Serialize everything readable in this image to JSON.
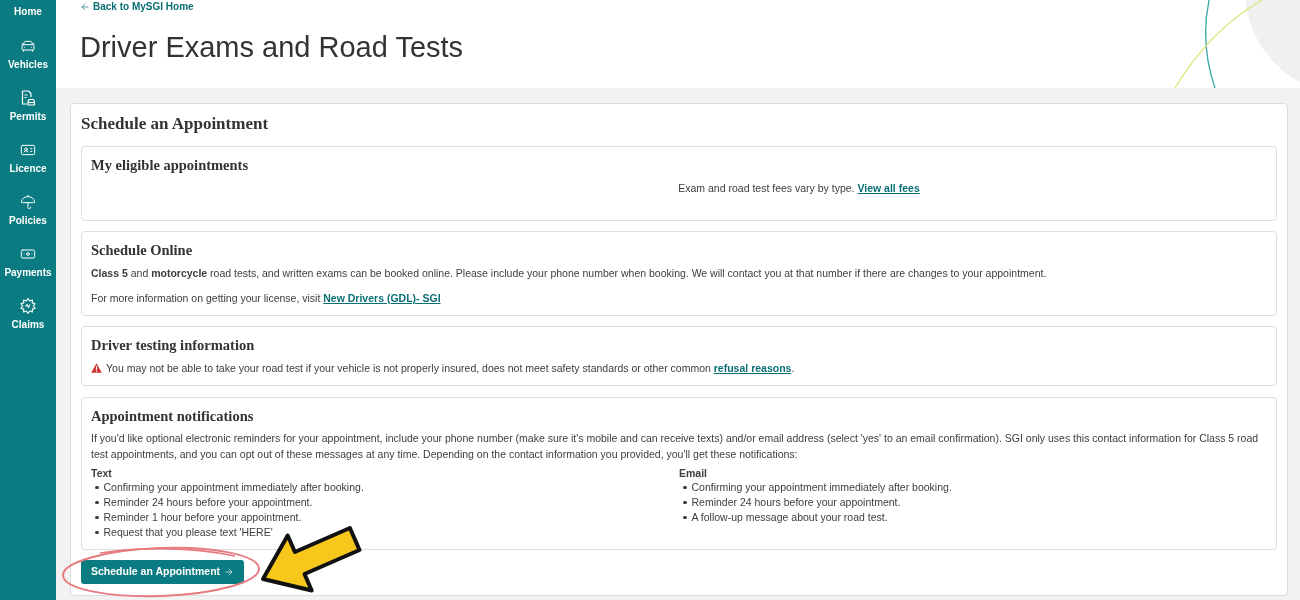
{
  "sidebar": {
    "items": [
      {
        "label": "Home"
      },
      {
        "label": "Vehicles"
      },
      {
        "label": "Permits"
      },
      {
        "label": "Licence"
      },
      {
        "label": "Policies"
      },
      {
        "label": "Payments"
      },
      {
        "label": "Claims"
      }
    ]
  },
  "header": {
    "back_link": "Back to MySGI Home",
    "title": "Driver Exams and Road Tests"
  },
  "card": {
    "title": "Schedule an Appointment",
    "eligible_appointments": {
      "title": "My eligible appointments",
      "fees_note": "Exam and road test fees vary by type.",
      "fees_link": "View all fees"
    },
    "schedule_online": {
      "title": "Schedule Online",
      "intro": "**Class 5** and **motorcycle** road tests, and written exams can be booked online. Please include your phone number when booking. We will contact you at that number if there are changes to your appointment.",
      "info": "For more information on getting your license, visit",
      "info_link": "New Drivers (GDL)- SGI"
    },
    "driver_testing": {
      "title": "Driver testing information",
      "warning": "You may not be able to take your road test if your vehicle is not properly insured, does not meet safety standards or other common",
      "warning_link": "refusal reasons",
      "warning_end": "."
    },
    "notifications": {
      "title": "Appointment notifications",
      "intro": "If you'd like optional electronic reminders for your appointment, include your phone number (make sure it's mobile and can receive texts) and/or email address (select 'yes' to an email confirmation). SGI only uses this contact information for Class 5 road test appointments, and you can opt out of these messages at any time. Depending on the contact information you provided, you'll get these notifications:",
      "columns": [
        {
          "heading": "Text",
          "items": [
            "Confirming your appointment immediately after booking.",
            "Reminder 24 hours before your appointment.",
            "Reminder 1 hour before your appointment.",
            "Request that you please text 'HERE'"
          ]
        },
        {
          "heading": "Email",
          "items": [
            "Confirming your appointment immediately after booking.",
            "Reminder 24 hours before your appointment.",
            "A follow-up message about your road test."
          ]
        }
      ]
    },
    "button": "Schedule an Appointment"
  }
}
